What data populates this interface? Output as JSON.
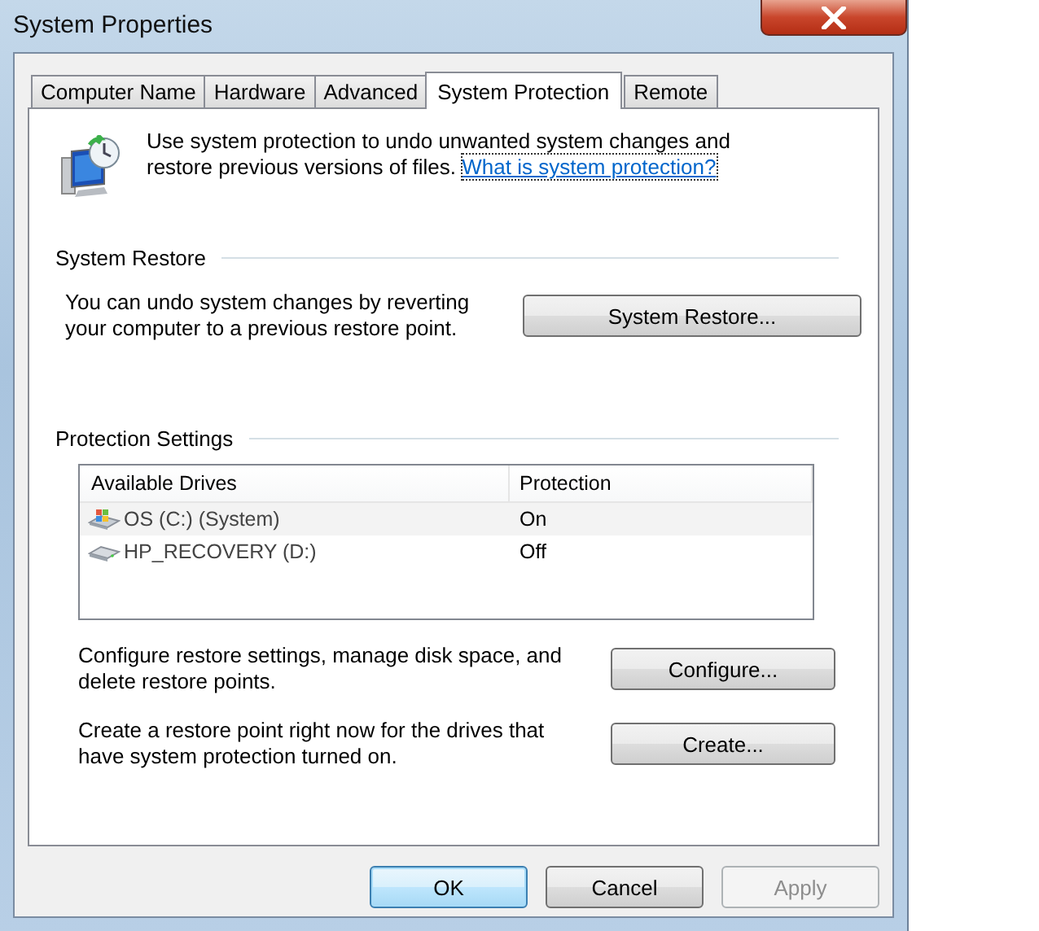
{
  "window": {
    "title": "System Properties"
  },
  "tabs": [
    {
      "label": "Computer Name",
      "selected": false
    },
    {
      "label": "Hardware",
      "selected": false
    },
    {
      "label": "Advanced",
      "selected": false
    },
    {
      "label": "System Protection",
      "selected": true
    },
    {
      "label": "Remote",
      "selected": false
    }
  ],
  "intro": {
    "text": "Use system protection to undo unwanted system changes and restore previous versions of files.",
    "link": "What is system protection?"
  },
  "system_restore": {
    "heading": "System Restore",
    "text": "You can undo system changes by reverting your computer to a previous restore point.",
    "button": "System Restore..."
  },
  "protection_settings": {
    "heading": "Protection Settings",
    "columns": [
      "Available Drives",
      "Protection"
    ],
    "drives": [
      {
        "name": "OS (C:) (System)",
        "protection": "On",
        "kind": "system",
        "selected": true
      },
      {
        "name": "HP_RECOVERY (D:)",
        "protection": "Off",
        "kind": "drive",
        "selected": false
      }
    ],
    "actions": [
      {
        "text": "Configure restore settings, manage disk space, and delete restore points.",
        "button": "Configure..."
      },
      {
        "text": "Create a restore point right now for the drives that have system protection turned on.",
        "button": "Create..."
      }
    ]
  },
  "buttons": [
    {
      "label": "OK",
      "default": true,
      "disabled": false
    },
    {
      "label": "Cancel",
      "default": false,
      "disabled": false
    },
    {
      "label": "Apply",
      "default": false,
      "disabled": true
    }
  ]
}
